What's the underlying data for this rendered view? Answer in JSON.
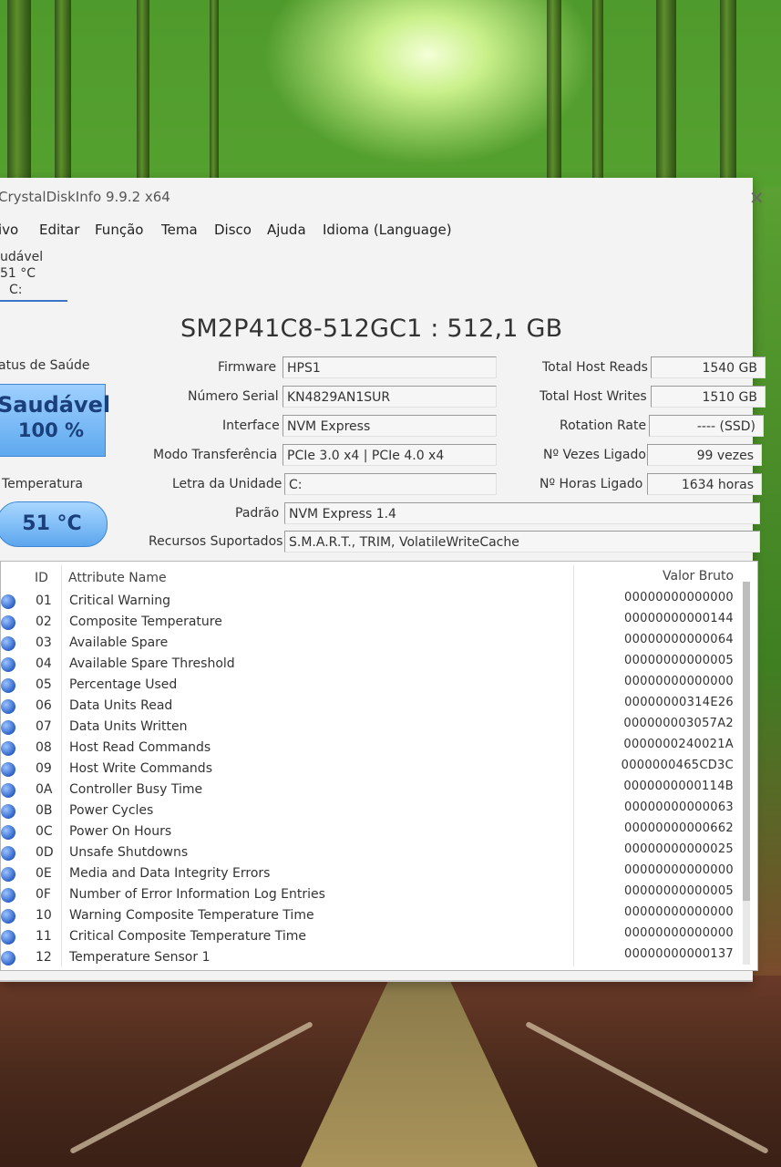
{
  "window": {
    "title": "CrystalDiskInfo 9.9.2 x64",
    "close": "✕"
  },
  "menu": [
    "ivo",
    "Editar",
    "Função",
    "Tema",
    "Disco",
    "Ajuda",
    "Idioma (Language)"
  ],
  "disk_tab": {
    "status": "udável",
    "temp": "51 °C",
    "drive": "C:"
  },
  "model": "SM2P41C8-512GC1 : 512,1 GB",
  "labels": {
    "health_status": "atus de Saúde",
    "temperature": "Temperatura",
    "firmware": "Firmware",
    "serial": "Número Serial",
    "interface": "Interface",
    "transfer": "Modo Transferência",
    "drive_letter": "Letra da Unidade",
    "standard": "Padrão",
    "features": "Recursos Suportados",
    "host_reads": "Total Host Reads",
    "host_writes": "Total Host Writes",
    "rotation": "Rotation Rate",
    "power_count": "Nº Vezes Ligado",
    "power_hours": "Nº Horas Ligado"
  },
  "values": {
    "firmware": "HPS1",
    "serial": "KN4829AN1SUR",
    "interface": "NVM Express",
    "transfer": "PCIe 3.0 x4 | PCIe 4.0 x4",
    "drive_letter": "C:",
    "standard": "NVM Express 1.4",
    "features": "S.M.A.R.T., TRIM, VolatileWriteCache",
    "host_reads": "1540 GB",
    "host_writes": "1510 GB",
    "rotation": "---- (SSD)",
    "power_count": "99 vezes",
    "power_hours": "1634 horas"
  },
  "health": {
    "status": "Saudável",
    "percent": "100 %",
    "temperature": "51 °C"
  },
  "table": {
    "headers": {
      "id": "ID",
      "name": "Attribute Name",
      "raw": "Valor Bruto"
    },
    "rows": [
      {
        "id": "01",
        "name": "Critical Warning",
        "raw": "00000000000000"
      },
      {
        "id": "02",
        "name": "Composite Temperature",
        "raw": "00000000000144"
      },
      {
        "id": "03",
        "name": "Available Spare",
        "raw": "00000000000064"
      },
      {
        "id": "04",
        "name": "Available Spare Threshold",
        "raw": "00000000000005"
      },
      {
        "id": "05",
        "name": "Percentage Used",
        "raw": "00000000000000"
      },
      {
        "id": "06",
        "name": "Data Units Read",
        "raw": "00000000314E26"
      },
      {
        "id": "07",
        "name": "Data Units Written",
        "raw": "000000003057A2"
      },
      {
        "id": "08",
        "name": "Host Read Commands",
        "raw": "0000000240021A"
      },
      {
        "id": "09",
        "name": "Host Write Commands",
        "raw": "0000000465CD3C"
      },
      {
        "id": "0A",
        "name": "Controller Busy Time",
        "raw": "0000000000114B"
      },
      {
        "id": "0B",
        "name": "Power Cycles",
        "raw": "00000000000063"
      },
      {
        "id": "0C",
        "name": "Power On Hours",
        "raw": "00000000000662"
      },
      {
        "id": "0D",
        "name": "Unsafe Shutdowns",
        "raw": "00000000000025"
      },
      {
        "id": "0E",
        "name": "Media and Data Integrity Errors",
        "raw": "00000000000000"
      },
      {
        "id": "0F",
        "name": "Number of Error Information Log Entries",
        "raw": "00000000000005"
      },
      {
        "id": "10",
        "name": "Warning Composite Temperature Time",
        "raw": "00000000000000"
      },
      {
        "id": "11",
        "name": "Critical Composite Temperature Time",
        "raw": "00000000000000"
      },
      {
        "id": "12",
        "name": "Temperature Sensor 1",
        "raw": "00000000000137"
      }
    ]
  },
  "icons": {
    "row_status": "status-dot-icon",
    "close": "close-icon"
  },
  "colors": {
    "health_blue": "#5ea9ef",
    "accent": "#3a74c8"
  }
}
